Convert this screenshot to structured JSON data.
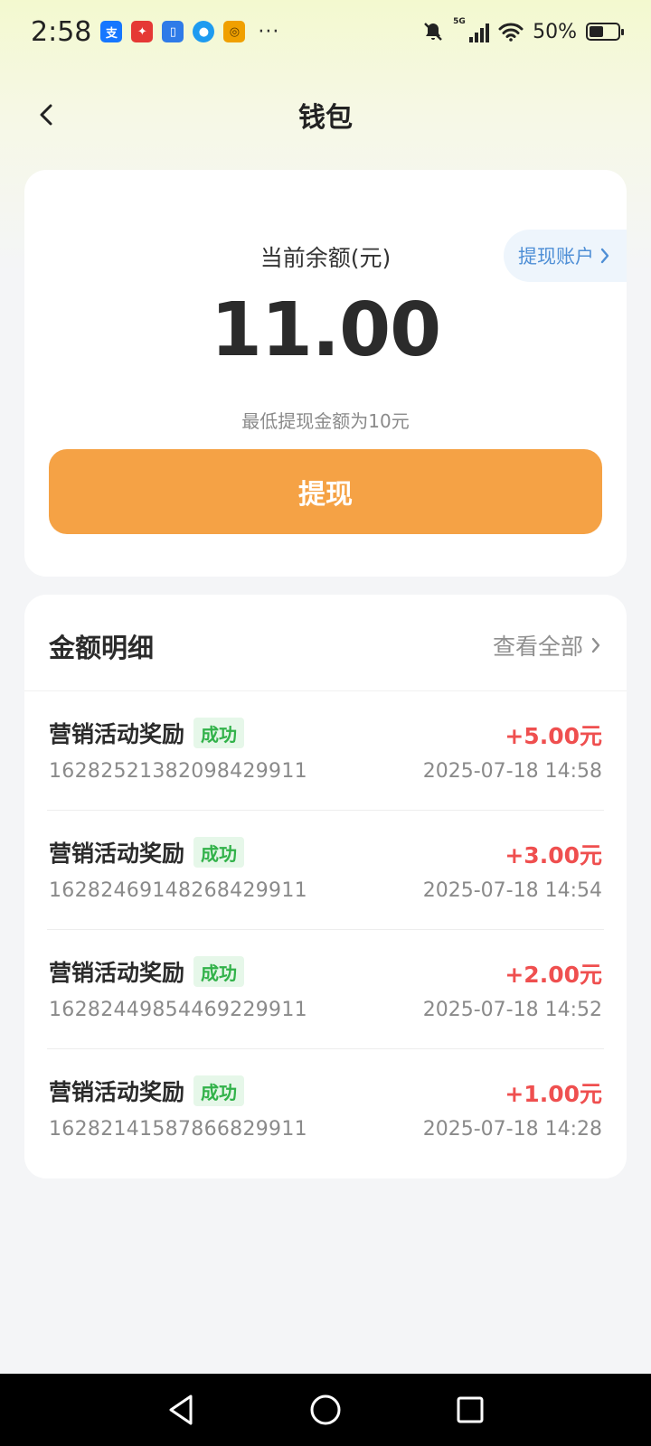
{
  "status_bar": {
    "time": "2:58",
    "battery": "50%",
    "battery_level": 0.5,
    "more_dots": "···",
    "network_label": "5G",
    "notification_icons": [
      "alipay-icon",
      "app-red-icon",
      "app-blue-icon",
      "message-icon",
      "music-icon"
    ]
  },
  "header": {
    "title": "钱包"
  },
  "balance": {
    "label": "当前余额(元)",
    "amount": "11.00",
    "withdraw_account_label": "提现账户",
    "min_note": "最低提现金额为10元",
    "withdraw_button_label": "提现"
  },
  "details": {
    "title": "金额明细",
    "view_all_label": "查看全部",
    "records": [
      {
        "title": "营销活动奖励",
        "status": "成功",
        "id": "1628252138209842991​1",
        "amount": "+5.00元",
        "time": "2025-07-18 14:58"
      },
      {
        "title": "营销活动奖励",
        "status": "成功",
        "id": "16282469148268429911",
        "amount": "+3.00元",
        "time": "2025-07-18 14:54"
      },
      {
        "title": "营销活动奖励",
        "status": "成功",
        "id": "16282449854469229911",
        "amount": "+2.00元",
        "time": "2025-07-18 14:52"
      },
      {
        "title": "营销活动奖励",
        "status": "成功",
        "id": "16282141587866829911",
        "amount": "+1.00元",
        "time": "2025-07-18 14:28"
      }
    ]
  },
  "colors": {
    "accent_orange": "#f5a245",
    "amount_red": "#ef4f4f",
    "success_green": "#32b24a",
    "link_blue": "#4f8fd6"
  }
}
